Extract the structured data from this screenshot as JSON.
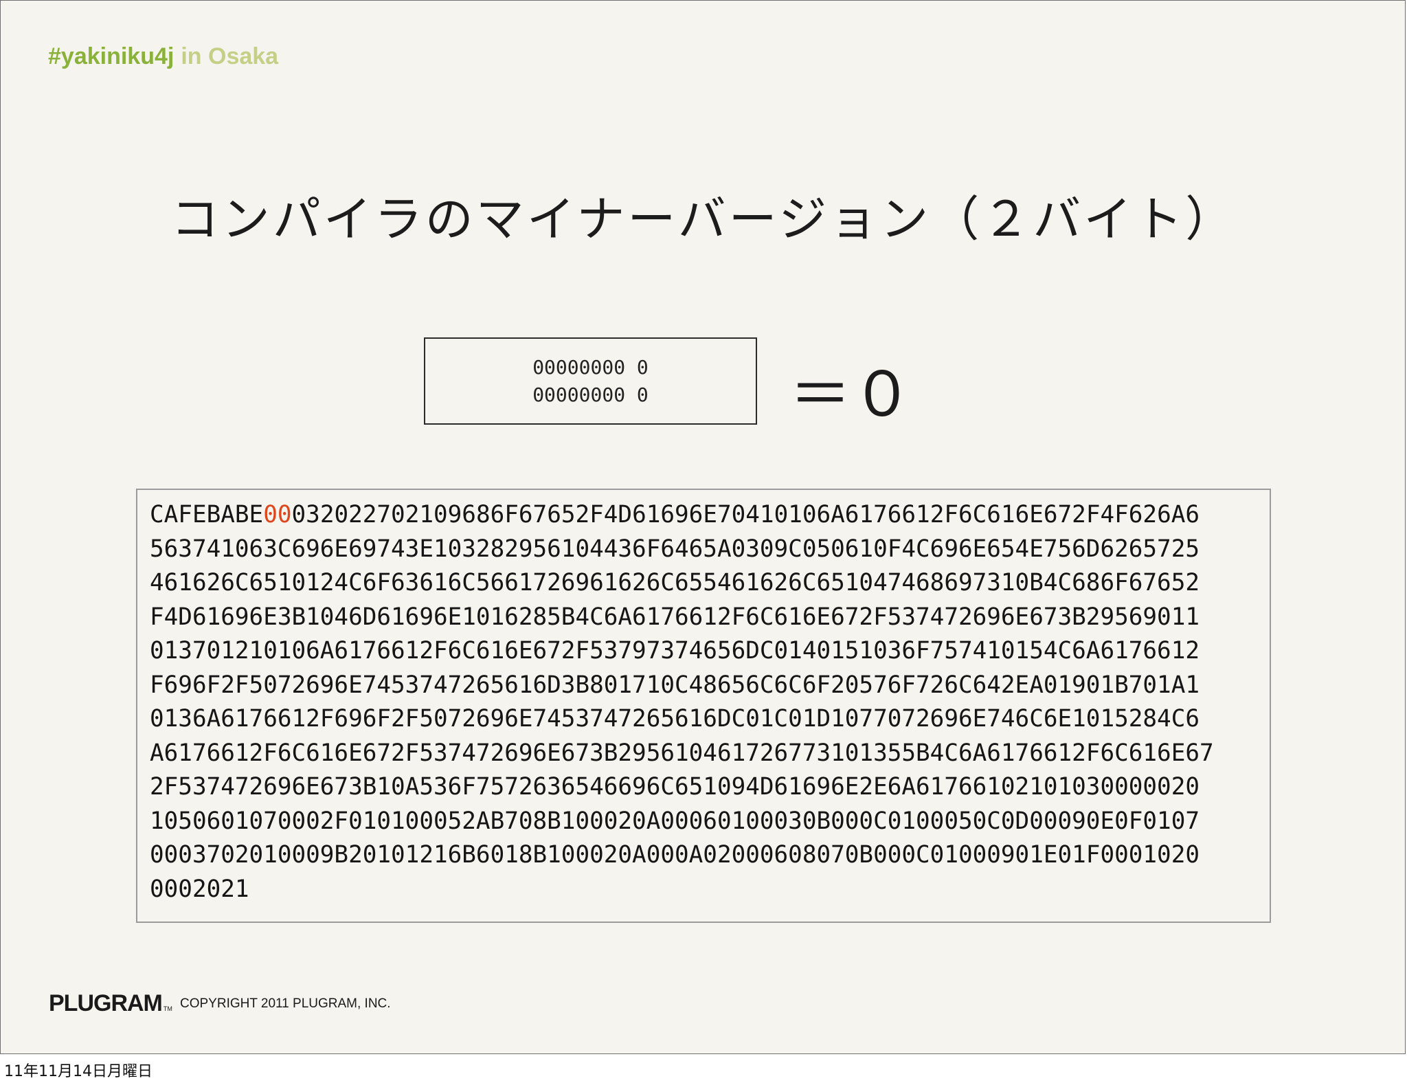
{
  "header": {
    "hashtag": "#yakiniku4j",
    "location": "in Osaka"
  },
  "title": "コンパイラのマイナーバージョン（２バイト）",
  "byte_box": {
    "row1": "00000000 0",
    "row2": "00000000 0"
  },
  "result": "＝０",
  "hex_dump": {
    "first_line": {
      "prefix": "CAFEBABE",
      "highlight": "00",
      "rest": "032022702109686F67652F4D61696E70410106A6176612F6C616E672F4F626A6"
    },
    "lines": [
      "563741063C696E69743E103282956104436F6465A0309C050610F4C696E654E756D6265725",
      "461626C6510124C6F63616C5661726961626C655461626C651047468697310B4C686F67652",
      "F4D61696E3B1046D61696E1016285B4C6A6176612F6C616E672F537472696E673B29569011",
      "013701210106A6176612F6C616E672F53797374656DC0140151036F757410154C6A6176612",
      "F696F2F5072696E7453747265616D3B801710C48656C6C6F20576F726C642EA01901B701A1",
      "0136A6176612F696F2F5072696E7453747265616DC01C01D1077072696E746C6E1015284C6",
      "A6176612F6C616E672F537472696E673B295610461726773101355B4C6A6176612F6C616E67",
      "2F537472696E673B10A536F7572636546696C651094D61696E2E6A61766102101030000020",
      "1050601070002F010100052AB708B100020A00060100030B000C0100050C0D00090E0F0107",
      "0003702010009B20101216B6018B100020A000A02000608070B000C01000901E01F0001020",
      "0002021"
    ],
    "highlight_color": "#e0461c"
  },
  "footer": {
    "logo": "PLUGRAM",
    "trademark": "TM",
    "copyright": "COPYRIGHT 2011 PLUGRAM, INC.",
    "datestamp": "11年11月14日月曜日"
  },
  "colors": {
    "background": "#f6f4ee",
    "hashtag": "#8ab23a",
    "location": "#c5cf86"
  }
}
